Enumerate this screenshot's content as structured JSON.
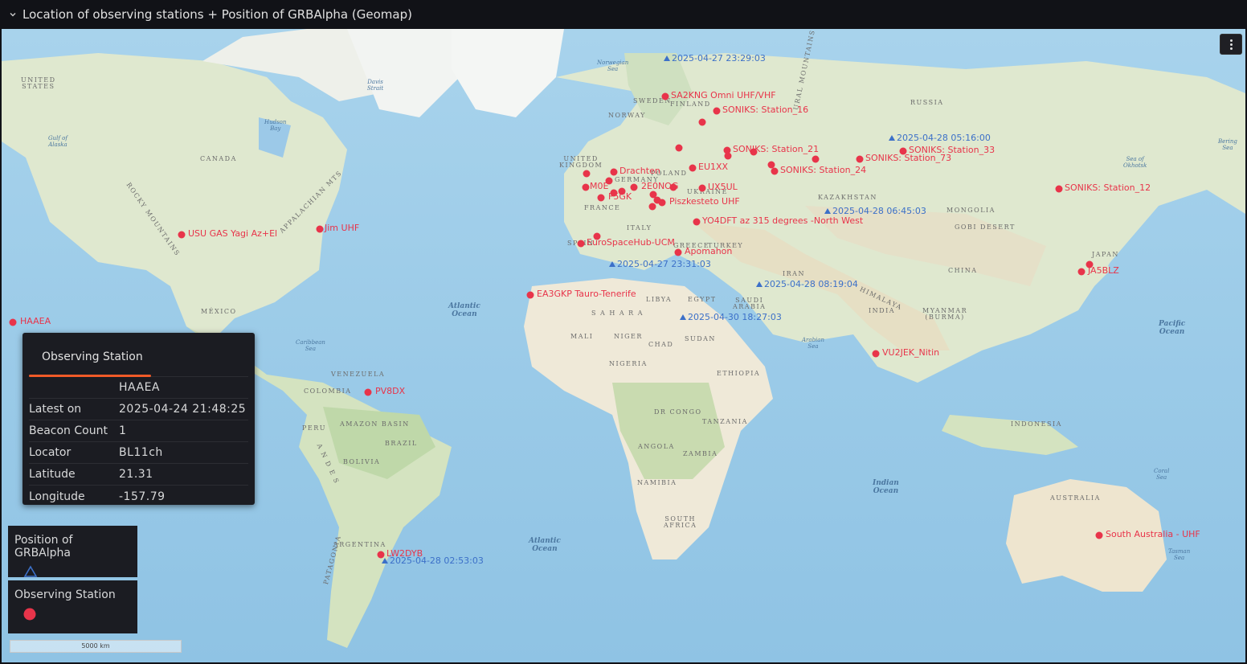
{
  "panel": {
    "title": "Location of observing stations + Position of GRBAlpha (Geomap)"
  },
  "colors": {
    "station": "#e8344a",
    "satellite": "#3c70c8",
    "tooltip_accent": "#f05a28"
  },
  "map": {
    "countries": [
      {
        "label": "UNITED\nSTATES"
      },
      {
        "label": "CANADA"
      },
      {
        "label": "MÉXICO"
      },
      {
        "label": "UNITED\nKINGDOM"
      },
      {
        "label": "SWEDEN"
      },
      {
        "label": "FINLAND"
      },
      {
        "label": "NORWAY"
      },
      {
        "label": "RUSSIA"
      },
      {
        "label": "FRANCE"
      },
      {
        "label": "ITALY"
      },
      {
        "label": "TURKEY"
      },
      {
        "label": "UKRAINE"
      },
      {
        "label": "KAZAKHSTAN"
      },
      {
        "label": "MONGOLIA"
      },
      {
        "label": "GOBI DESERT"
      },
      {
        "label": "CHINA"
      },
      {
        "label": "JAPAN"
      },
      {
        "label": "IRAN"
      },
      {
        "label": "INDIA"
      },
      {
        "label": "MYANMAR\n(BURMA)"
      },
      {
        "label": "SAUDI\nARABIA"
      },
      {
        "label": "EGYPT"
      },
      {
        "label": "LIBYA"
      },
      {
        "label": "S A H A R A"
      },
      {
        "label": "MALI"
      },
      {
        "label": "NIGER"
      },
      {
        "label": "CHAD"
      },
      {
        "label": "SUDAN"
      },
      {
        "label": "NIGERIA"
      },
      {
        "label": "ETHIOPIA"
      },
      {
        "label": "DR CONGO"
      },
      {
        "label": "TANZANIA"
      },
      {
        "label": "ANGOLA"
      },
      {
        "label": "ZAMBIA"
      },
      {
        "label": "NAMIBIA"
      },
      {
        "label": "SOUTH\nAFRICA"
      },
      {
        "label": "INDONESIA"
      },
      {
        "label": "AUSTRALIA"
      },
      {
        "label": "VENEZUELA"
      },
      {
        "label": "COLOMBIA"
      },
      {
        "label": "PERU"
      },
      {
        "label": "BRAZIL"
      },
      {
        "label": "BOLIVIA"
      },
      {
        "label": "AMAZON BASIN"
      },
      {
        "label": "ARGENTINA"
      },
      {
        "label": "PATAGONIA"
      },
      {
        "label": "HIMALAYA"
      },
      {
        "label": "URAL MOUNTAINS"
      },
      {
        "label": "ROCKY MOUNTAINS"
      },
      {
        "label": "APPALACHIAN MTS"
      },
      {
        "label": "A N D E S"
      },
      {
        "label": "GREECE"
      },
      {
        "label": "POLAND"
      },
      {
        "label": "GERMANY"
      },
      {
        "label": "SPAIN"
      }
    ],
    "oceans": [
      {
        "label": "Atlantic\nOcean"
      },
      {
        "label": "Atlantic\nOcean"
      },
      {
        "label": "Pacific\nOcean"
      },
      {
        "label": "Indian\nOcean"
      },
      {
        "label": "Norwegian\nSea"
      },
      {
        "label": "Davis\nStrait"
      },
      {
        "label": "Hudson\nBay"
      },
      {
        "label": "Gulf of\nAlaska"
      },
      {
        "label": "Caribbean\nSea"
      },
      {
        "label": "Arabian\nSea"
      },
      {
        "label": "Bering\nSea"
      },
      {
        "label": "Sea of\nOkhotsk"
      },
      {
        "label": "Coral\nSea"
      },
      {
        "label": "Tasman\nSea"
      }
    ],
    "stations": [
      {
        "name": "SA2KNG Omni UHF/VHF"
      },
      {
        "name": "SONIKS: Station_16"
      },
      {
        "name": "SONIKS: Station_21"
      },
      {
        "name": "SONIKS: Station_73"
      },
      {
        "name": "SONIKS: Station_33"
      },
      {
        "name": "SONIKS: Station_24"
      },
      {
        "name": "SONIKS: Station_12"
      },
      {
        "name": "Drachten"
      },
      {
        "name": "EU1XX"
      },
      {
        "name": "UX5UL"
      },
      {
        "name": "Piszkesteto UHF"
      },
      {
        "name": "YO4DFT az 315 degrees -North West"
      },
      {
        "name": "2E0NOG"
      },
      {
        "name": "M0E"
      },
      {
        "name": "F5GK"
      },
      {
        "name": "EuroSpaceHub-UCM"
      },
      {
        "name": "Apomahon"
      },
      {
        "name": "EA3GKP Tauro-Tenerife"
      },
      {
        "name": "USU GAS Yagi Az+El"
      },
      {
        "name": "Jim UHF"
      },
      {
        "name": "HAAEA"
      },
      {
        "name": "PV8DX"
      },
      {
        "name": "LW2DYB"
      },
      {
        "name": "JA5BLZ"
      },
      {
        "name": "VU2JEK_Nitin"
      },
      {
        "name": "South Australia - UHF"
      },
      {
        "name": ""
      },
      {
        "name": ""
      },
      {
        "name": ""
      },
      {
        "name": ""
      },
      {
        "name": ""
      },
      {
        "name": ""
      },
      {
        "name": ""
      },
      {
        "name": ""
      },
      {
        "name": ""
      },
      {
        "name": ""
      },
      {
        "name": ""
      },
      {
        "name": ""
      },
      {
        "name": ""
      },
      {
        "name": ""
      },
      {
        "name": ""
      },
      {
        "name": ""
      }
    ],
    "satellite_positions": [
      {
        "time": "2025-04-27 23:29:03"
      },
      {
        "time": "2025-04-28 05:16:00"
      },
      {
        "time": "2025-04-28 06:45:03"
      },
      {
        "time": "2025-04-27 23:31:03"
      },
      {
        "time": "2025-04-28 08:19:04"
      },
      {
        "time": "2025-04-30 18:27:03"
      },
      {
        "time": "2025-04-28 02:53:03"
      }
    ],
    "scale_label": "5000 km"
  },
  "tooltip": {
    "tab": "Observing Station",
    "header_value": "HAAEA",
    "rows": [
      {
        "key": "Latest on",
        "value": "2025-04-24 21:48:25"
      },
      {
        "key": "Beacon Count",
        "value": "1"
      },
      {
        "key": "Locator",
        "value": "BL11ch"
      },
      {
        "key": "Latitude",
        "value": "21.31"
      },
      {
        "key": "Longitude",
        "value": "-157.79"
      }
    ]
  },
  "legend": {
    "satellite_title": "Position of GRBAlpha",
    "station_title": "Observing Station"
  }
}
